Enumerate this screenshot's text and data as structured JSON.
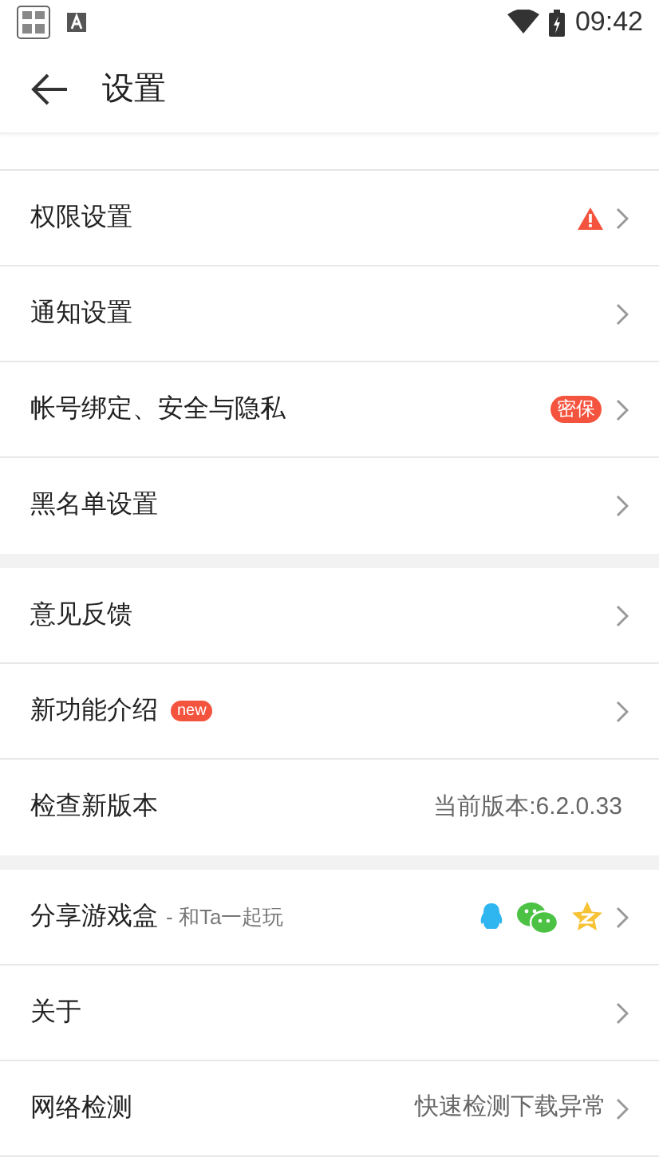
{
  "status_bar": {
    "time": "09:42"
  },
  "header": {
    "title": "设置"
  },
  "sections": [
    {
      "items": [
        {
          "label": "权限设置",
          "alert": true,
          "chevron": true
        },
        {
          "label": "通知设置",
          "chevron": true
        },
        {
          "label": "帐号绑定、安全与隐私",
          "badge": {
            "kind": "pill",
            "text": "密保"
          },
          "chevron": true
        },
        {
          "label": "黑名单设置",
          "chevron": true
        }
      ]
    },
    {
      "items": [
        {
          "label": "意见反馈",
          "chevron": true
        },
        {
          "label": "新功能介绍",
          "badge": {
            "kind": "new",
            "text": "new"
          },
          "chevron": true
        },
        {
          "label": "检查新版本",
          "value": "当前版本:6.2.0.33",
          "chevron": false
        }
      ]
    },
    {
      "items": [
        {
          "label": "分享游戏盒",
          "sublabel": "- 和Ta一起玩",
          "share": [
            {
              "kind": "qq"
            },
            {
              "kind": "wechat"
            },
            {
              "kind": "qzone"
            }
          ],
          "chevron": true
        },
        {
          "label": "关于",
          "chevron": true
        },
        {
          "label": "网络检测",
          "value": "快速检测下载异常",
          "chevron": true
        }
      ]
    }
  ]
}
